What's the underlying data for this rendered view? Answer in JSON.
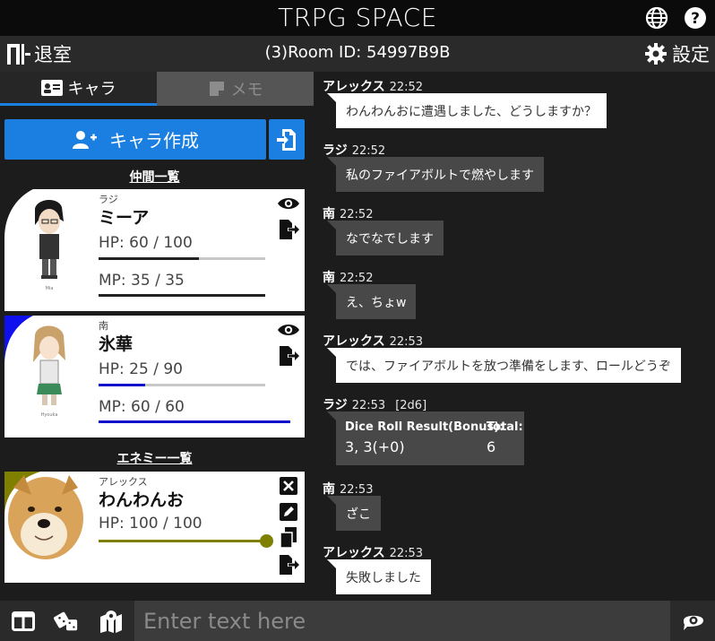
{
  "app": {
    "title": "TRPG SPACE"
  },
  "header": {
    "exit_label": "退室",
    "room_text": "(3)Room ID: 54997B9B",
    "settings_label": "設定"
  },
  "tabs": {
    "chara": "キャラ",
    "memo": "メモ"
  },
  "create_button": "キャラ作成",
  "party_title": "仲間一覧",
  "enemy_title": "エネミー一覧",
  "party": [
    {
      "owner": "ラジ",
      "name": "ミーア",
      "hp_text": "HP: 60 / 100",
      "mp_text": "MP: 35 / 35",
      "hp_fraction": 0.6,
      "mp_fraction": 1.0,
      "bar_color": "#222222",
      "accent": "#ffffff",
      "portrait_caption": "Mia"
    },
    {
      "owner": "南",
      "name": "氷華",
      "hp_text": "HP: 25 / 90",
      "mp_text": "MP: 60 / 60",
      "hp_fraction": 0.278,
      "mp_fraction": 1.0,
      "bar_color": "#1010cc",
      "accent": "#1010ee",
      "portrait_caption": "Hyouka"
    }
  ],
  "enemies": [
    {
      "owner": "アレックス",
      "name": "わんわんお",
      "hp_text": "HP: 100 / 100",
      "hp_fraction": 1.0,
      "bar_color": "#7f7f00",
      "accent": "#7f7f00"
    }
  ],
  "messages": [
    {
      "who": "アレックス",
      "time": "22:52",
      "text": "わんわんおに遭遇しました、どうしますか？",
      "style": "light"
    },
    {
      "who": "ラジ",
      "time": "22:52",
      "text": "私のファイアボルトで燃やします",
      "style": "dark"
    },
    {
      "who": "南",
      "time": "22:52",
      "text": "なでなでします",
      "style": "dark"
    },
    {
      "who": "南",
      "time": "22:52",
      "text": "え、ちょw",
      "style": "dark"
    },
    {
      "who": "アレックス",
      "time": "22:53",
      "text": "では、ファイアボルトを放つ準備をします、ロールどうぞ",
      "style": "light"
    },
    {
      "who": "ラジ",
      "time": "22:53",
      "command": "[2d6]",
      "dice_header": "Dice Roll Result(Bonus):",
      "dice_total_label": "Total:",
      "dice_result": "3, 3(+0)",
      "dice_total": "6",
      "style": "dice"
    },
    {
      "who": "南",
      "time": "22:53",
      "text": "ざこ",
      "style": "dark"
    },
    {
      "who": "アレックス",
      "time": "22:53",
      "text": "失敗しました",
      "style": "light"
    }
  ],
  "input": {
    "placeholder": "Enter text here"
  },
  "colors": {
    "accent": "#1a7fe0",
    "topbar": "#0b0b0b",
    "panel": "#1c1c1c"
  },
  "icons": [
    "globe-icon",
    "help-icon",
    "door-exit-icon",
    "gear-icon",
    "id-card-icon",
    "note-icon",
    "user-plus-icon",
    "file-import-icon",
    "eye-icon",
    "file-export-icon",
    "close-icon",
    "pencil-icon",
    "copy-icon",
    "layout-columns-icon",
    "dice-icon",
    "map-icon",
    "chat-settings-icon"
  ]
}
